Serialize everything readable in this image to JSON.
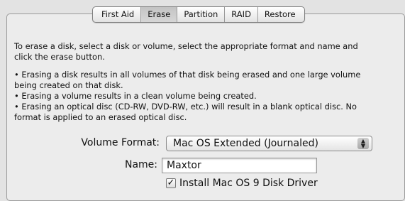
{
  "tabs": [
    {
      "label": "First Aid",
      "active": false
    },
    {
      "label": "Erase",
      "active": true
    },
    {
      "label": "Partition",
      "active": false
    },
    {
      "label": "RAID",
      "active": false
    },
    {
      "label": "Restore",
      "active": false
    }
  ],
  "intro": {
    "line1": "To erase a disk, select a disk or volume, select the appropriate format and name and",
    "line2": "click the erase button."
  },
  "bullets": {
    "b1_line1": "• Erasing a disk results in all volumes of that disk being erased and one large volume",
    "b1_line2": "being created on that disk.",
    "b2": "• Erasing a volume results in a clean volume being created.",
    "b3_line1": "• Erasing an optical disc (CD-RW, DVD-RW, etc.) will result in a blank optical disc.  No",
    "b3_line2": "format is applied to an erased optical disc."
  },
  "form": {
    "volume_format_label": "Volume Format:",
    "volume_format_value": "Mac OS Extended (Journaled)",
    "name_label": "Name:",
    "name_value": "Maxtor",
    "checkbox_label": "Install Mac OS 9 Disk Driver",
    "checkbox_checked": true
  }
}
